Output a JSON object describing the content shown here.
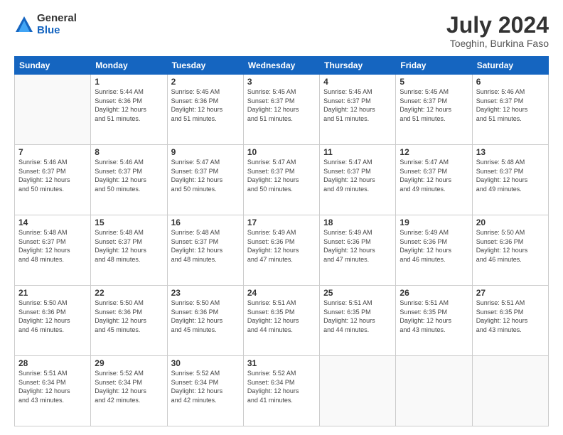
{
  "logo": {
    "general": "General",
    "blue": "Blue"
  },
  "title": "July 2024",
  "subtitle": "Toeghin, Burkina Faso",
  "days_of_week": [
    "Sunday",
    "Monday",
    "Tuesday",
    "Wednesday",
    "Thursday",
    "Friday",
    "Saturday"
  ],
  "weeks": [
    [
      {
        "day": "",
        "sunrise": "",
        "sunset": "",
        "daylight": ""
      },
      {
        "day": "1",
        "sunrise": "Sunrise: 5:44 AM",
        "sunset": "Sunset: 6:36 PM",
        "daylight": "Daylight: 12 hours and 51 minutes."
      },
      {
        "day": "2",
        "sunrise": "Sunrise: 5:45 AM",
        "sunset": "Sunset: 6:36 PM",
        "daylight": "Daylight: 12 hours and 51 minutes."
      },
      {
        "day": "3",
        "sunrise": "Sunrise: 5:45 AM",
        "sunset": "Sunset: 6:37 PM",
        "daylight": "Daylight: 12 hours and 51 minutes."
      },
      {
        "day": "4",
        "sunrise": "Sunrise: 5:45 AM",
        "sunset": "Sunset: 6:37 PM",
        "daylight": "Daylight: 12 hours and 51 minutes."
      },
      {
        "day": "5",
        "sunrise": "Sunrise: 5:45 AM",
        "sunset": "Sunset: 6:37 PM",
        "daylight": "Daylight: 12 hours and 51 minutes."
      },
      {
        "day": "6",
        "sunrise": "Sunrise: 5:46 AM",
        "sunset": "Sunset: 6:37 PM",
        "daylight": "Daylight: 12 hours and 51 minutes."
      }
    ],
    [
      {
        "day": "7",
        "sunrise": "Sunrise: 5:46 AM",
        "sunset": "Sunset: 6:37 PM",
        "daylight": "Daylight: 12 hours and 50 minutes."
      },
      {
        "day": "8",
        "sunrise": "Sunrise: 5:46 AM",
        "sunset": "Sunset: 6:37 PM",
        "daylight": "Daylight: 12 hours and 50 minutes."
      },
      {
        "day": "9",
        "sunrise": "Sunrise: 5:47 AM",
        "sunset": "Sunset: 6:37 PM",
        "daylight": "Daylight: 12 hours and 50 minutes."
      },
      {
        "day": "10",
        "sunrise": "Sunrise: 5:47 AM",
        "sunset": "Sunset: 6:37 PM",
        "daylight": "Daylight: 12 hours and 50 minutes."
      },
      {
        "day": "11",
        "sunrise": "Sunrise: 5:47 AM",
        "sunset": "Sunset: 6:37 PM",
        "daylight": "Daylight: 12 hours and 49 minutes."
      },
      {
        "day": "12",
        "sunrise": "Sunrise: 5:47 AM",
        "sunset": "Sunset: 6:37 PM",
        "daylight": "Daylight: 12 hours and 49 minutes."
      },
      {
        "day": "13",
        "sunrise": "Sunrise: 5:48 AM",
        "sunset": "Sunset: 6:37 PM",
        "daylight": "Daylight: 12 hours and 49 minutes."
      }
    ],
    [
      {
        "day": "14",
        "sunrise": "Sunrise: 5:48 AM",
        "sunset": "Sunset: 6:37 PM",
        "daylight": "Daylight: 12 hours and 48 minutes."
      },
      {
        "day": "15",
        "sunrise": "Sunrise: 5:48 AM",
        "sunset": "Sunset: 6:37 PM",
        "daylight": "Daylight: 12 hours and 48 minutes."
      },
      {
        "day": "16",
        "sunrise": "Sunrise: 5:48 AM",
        "sunset": "Sunset: 6:37 PM",
        "daylight": "Daylight: 12 hours and 48 minutes."
      },
      {
        "day": "17",
        "sunrise": "Sunrise: 5:49 AM",
        "sunset": "Sunset: 6:36 PM",
        "daylight": "Daylight: 12 hours and 47 minutes."
      },
      {
        "day": "18",
        "sunrise": "Sunrise: 5:49 AM",
        "sunset": "Sunset: 6:36 PM",
        "daylight": "Daylight: 12 hours and 47 minutes."
      },
      {
        "day": "19",
        "sunrise": "Sunrise: 5:49 AM",
        "sunset": "Sunset: 6:36 PM",
        "daylight": "Daylight: 12 hours and 46 minutes."
      },
      {
        "day": "20",
        "sunrise": "Sunrise: 5:50 AM",
        "sunset": "Sunset: 6:36 PM",
        "daylight": "Daylight: 12 hours and 46 minutes."
      }
    ],
    [
      {
        "day": "21",
        "sunrise": "Sunrise: 5:50 AM",
        "sunset": "Sunset: 6:36 PM",
        "daylight": "Daylight: 12 hours and 46 minutes."
      },
      {
        "day": "22",
        "sunrise": "Sunrise: 5:50 AM",
        "sunset": "Sunset: 6:36 PM",
        "daylight": "Daylight: 12 hours and 45 minutes."
      },
      {
        "day": "23",
        "sunrise": "Sunrise: 5:50 AM",
        "sunset": "Sunset: 6:36 PM",
        "daylight": "Daylight: 12 hours and 45 minutes."
      },
      {
        "day": "24",
        "sunrise": "Sunrise: 5:51 AM",
        "sunset": "Sunset: 6:35 PM",
        "daylight": "Daylight: 12 hours and 44 minutes."
      },
      {
        "day": "25",
        "sunrise": "Sunrise: 5:51 AM",
        "sunset": "Sunset: 6:35 PM",
        "daylight": "Daylight: 12 hours and 44 minutes."
      },
      {
        "day": "26",
        "sunrise": "Sunrise: 5:51 AM",
        "sunset": "Sunset: 6:35 PM",
        "daylight": "Daylight: 12 hours and 43 minutes."
      },
      {
        "day": "27",
        "sunrise": "Sunrise: 5:51 AM",
        "sunset": "Sunset: 6:35 PM",
        "daylight": "Daylight: 12 hours and 43 minutes."
      }
    ],
    [
      {
        "day": "28",
        "sunrise": "Sunrise: 5:51 AM",
        "sunset": "Sunset: 6:34 PM",
        "daylight": "Daylight: 12 hours and 43 minutes."
      },
      {
        "day": "29",
        "sunrise": "Sunrise: 5:52 AM",
        "sunset": "Sunset: 6:34 PM",
        "daylight": "Daylight: 12 hours and 42 minutes."
      },
      {
        "day": "30",
        "sunrise": "Sunrise: 5:52 AM",
        "sunset": "Sunset: 6:34 PM",
        "daylight": "Daylight: 12 hours and 42 minutes."
      },
      {
        "day": "31",
        "sunrise": "Sunrise: 5:52 AM",
        "sunset": "Sunset: 6:34 PM",
        "daylight": "Daylight: 12 hours and 41 minutes."
      },
      {
        "day": "",
        "sunrise": "",
        "sunset": "",
        "daylight": ""
      },
      {
        "day": "",
        "sunrise": "",
        "sunset": "",
        "daylight": ""
      },
      {
        "day": "",
        "sunrise": "",
        "sunset": "",
        "daylight": ""
      }
    ]
  ]
}
